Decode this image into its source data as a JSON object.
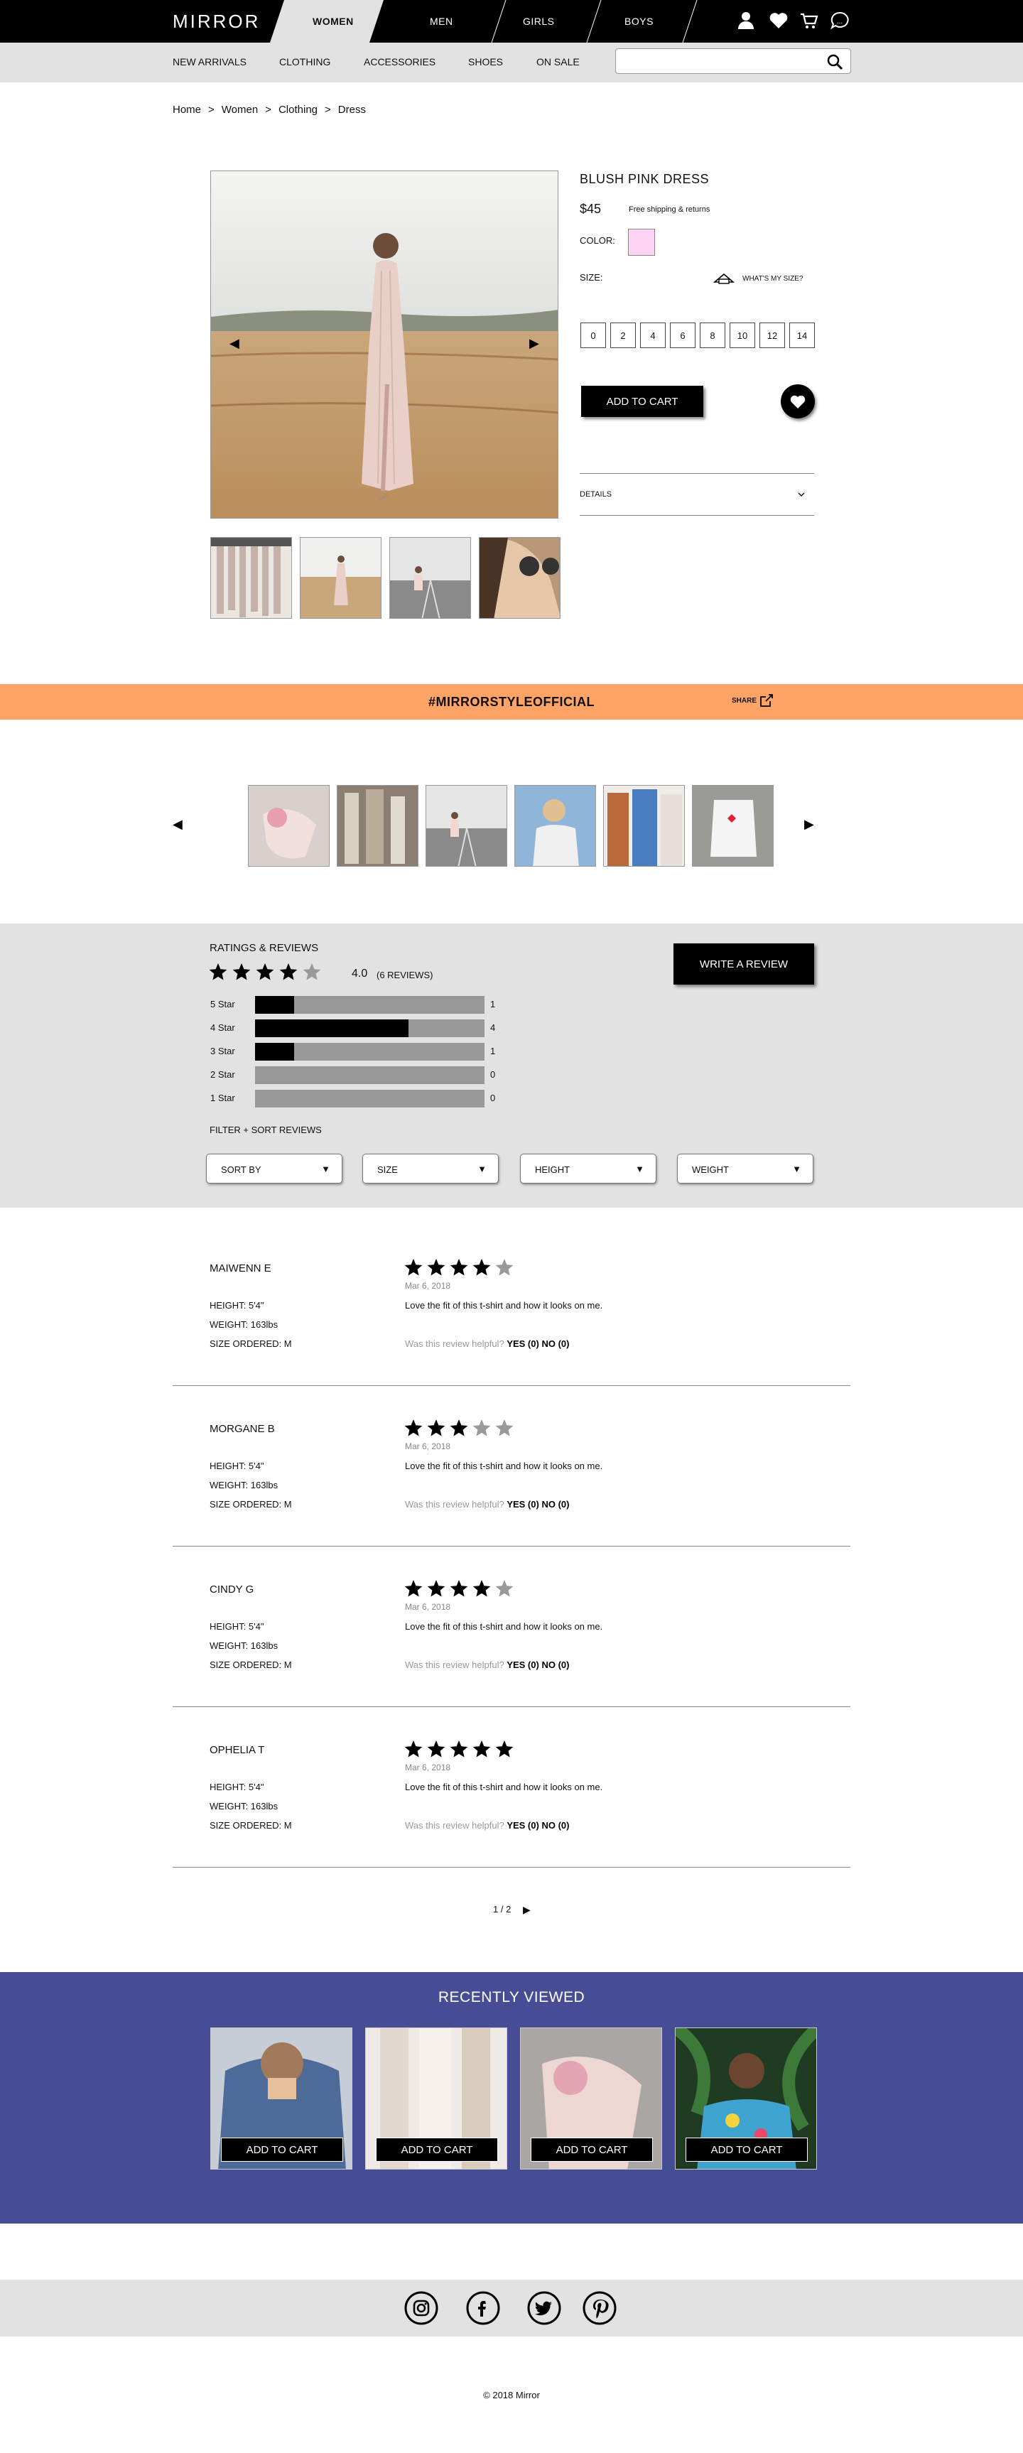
{
  "brand": "MIRROR",
  "nav": {
    "tabs": [
      "WOMEN",
      "MEN",
      "GIRLS",
      "BOYS"
    ],
    "active": "WOMEN"
  },
  "subnav": [
    "NEW ARRIVALS",
    "CLOTHING",
    "ACCESSORIES",
    "SHOES",
    "ON SALE"
  ],
  "search": {
    "placeholder": "",
    "value": ""
  },
  "breadcrumb": [
    "Home",
    ">",
    "Women",
    ">",
    "Clothing",
    ">",
    "Dress"
  ],
  "product": {
    "title": "BLUSH PINK DRESS",
    "price": "$45",
    "shipping": "Free shipping & returns",
    "color_label": "COLOR:",
    "color_value": "#fcd3f3",
    "size_label": "SIZE:",
    "whats_my_size": "WHAT'S MY SIZE?",
    "sizes": [
      "0",
      "2",
      "4",
      "6",
      "8",
      "10",
      "12",
      "14"
    ],
    "add_to_cart": "ADD TO CART",
    "details_label": "DETAILS"
  },
  "banner": {
    "hashtag": "#MIRRORSTYLEOFFICIAL",
    "share": "SHARE",
    "color": "#ffa366"
  },
  "reviews_summary": {
    "title": "RATINGS & REVIEWS",
    "average": "4.0",
    "count_label": "(6 REVIEWS)",
    "rating": 4,
    "write_review": "WRITE A REVIEW",
    "distribution": [
      {
        "label": "5 Star",
        "count": "1",
        "fraction": 0.17
      },
      {
        "label": "4 Star",
        "count": "4",
        "fraction": 0.67
      },
      {
        "label": "3 Star",
        "count": "1",
        "fraction": 0.17
      },
      {
        "label": "2 Star",
        "count": "0",
        "fraction": 0
      },
      {
        "label": "1 Star",
        "count": "0",
        "fraction": 0
      }
    ],
    "filter_label": "FILTER + SORT REVIEWS",
    "filters": [
      "SORT BY",
      "SIZE",
      "HEIGHT",
      "WEIGHT"
    ]
  },
  "reviews": [
    {
      "name": "MAIWENN E",
      "rating": 4,
      "date": "Mar 6, 2018",
      "text": "Love the fit of this t-shirt and how it looks on me.",
      "height": "HEIGHT: 5'4\"",
      "weight": "WEIGHT: 163lbs",
      "size": "SIZE ORDERED: M",
      "helpful": "Was this review helpful?",
      "yes": "YES (0)",
      "no": "NO (0)"
    },
    {
      "name": "MORGANE B",
      "rating": 3,
      "date": "Mar 6, 2018",
      "text": "Love the fit of this t-shirt and how it looks on me.",
      "height": "HEIGHT: 5'4\"",
      "weight": "WEIGHT: 163lbs",
      "size": "SIZE ORDERED: M",
      "helpful": "Was this review helpful?",
      "yes": "YES (0)",
      "no": "NO (0)"
    },
    {
      "name": "CINDY G",
      "rating": 4,
      "date": "Mar 6, 2018",
      "text": "Love the fit of this t-shirt and how it looks on me.",
      "height": "HEIGHT: 5'4\"",
      "weight": "WEIGHT: 163lbs",
      "size": "SIZE ORDERED: M",
      "helpful": "Was this review helpful?",
      "yes": "YES (0)",
      "no": "NO (0)"
    },
    {
      "name": "OPHELIA T",
      "rating": 5,
      "date": "Mar 6, 2018",
      "text": "Love the fit of this t-shirt and how it looks on me.",
      "height": "HEIGHT: 5'4\"",
      "weight": "WEIGHT: 163lbs",
      "size": "SIZE ORDERED: M",
      "helpful": "Was this review helpful?",
      "yes": "YES (0)",
      "no": "NO (0)"
    }
  ],
  "pagination": {
    "label": "1 / 2"
  },
  "recently_viewed": {
    "title": "RECENTLY VIEWED",
    "button": "ADD TO CART",
    "color": "#474d94"
  },
  "footer": {
    "copyright": "© 2018 Mirror"
  }
}
